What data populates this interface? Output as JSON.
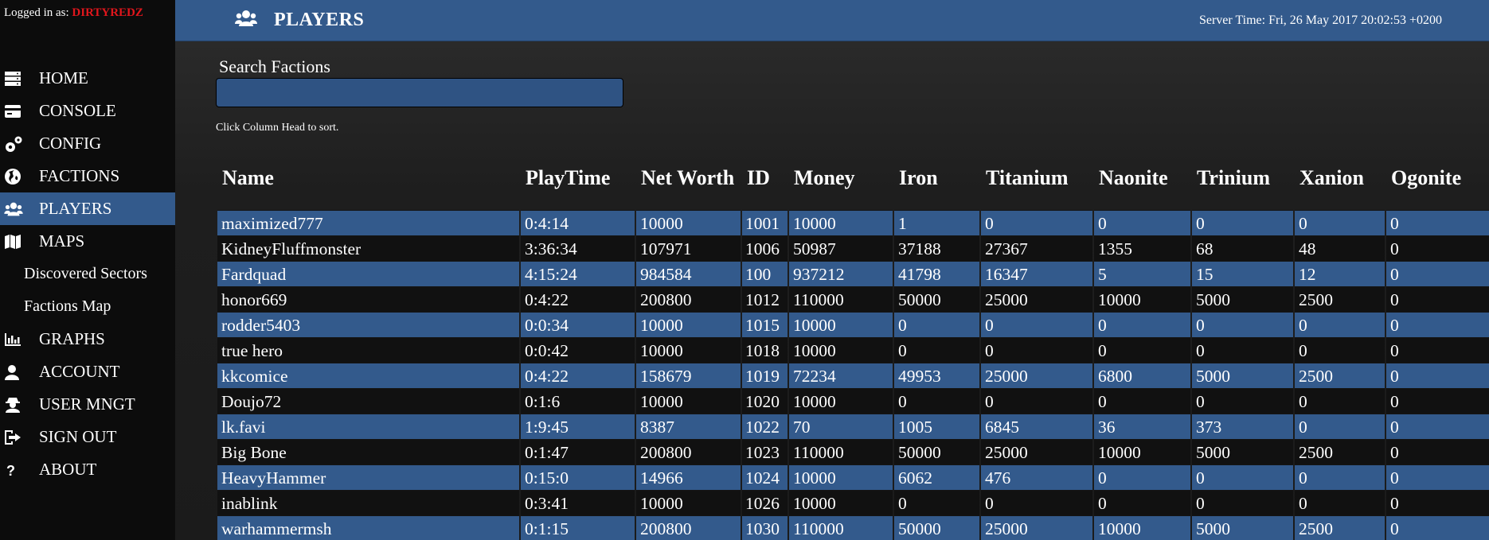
{
  "login": {
    "prefix": "Logged in as:",
    "username": "DIRTYREDZ"
  },
  "nav": [
    {
      "label": "HOME",
      "icon": "server-icon",
      "active": false
    },
    {
      "label": "CONSOLE",
      "icon": "credit-card-icon",
      "active": false
    },
    {
      "label": "CONFIG",
      "icon": "gears-icon",
      "active": false
    },
    {
      "label": "FACTIONS",
      "icon": "globe-icon",
      "active": false
    },
    {
      "label": "PLAYERS",
      "icon": "users-icon",
      "active": true
    },
    {
      "label": "MAPS",
      "icon": "map-icon",
      "active": false
    },
    {
      "label": "Discovered Sectors",
      "icon": "",
      "active": false,
      "sub": true
    },
    {
      "label": "Factions Map",
      "icon": "",
      "active": false,
      "sub": true
    },
    {
      "label": "GRAPHS",
      "icon": "bar-chart-icon",
      "active": false
    },
    {
      "label": "ACCOUNT",
      "icon": "user-icon",
      "active": false
    },
    {
      "label": "USER MNGT",
      "icon": "user-secret-icon",
      "active": false
    },
    {
      "label": "SIGN OUT",
      "icon": "sign-out-icon",
      "active": false
    },
    {
      "label": "ABOUT",
      "icon": "question-icon",
      "active": false
    }
  ],
  "header": {
    "title": "PLAYERS",
    "icon": "users-icon",
    "server_time": "Server Time: Fri, 26 May 2017 20:02:53 +0200"
  },
  "search": {
    "label": "Search Factions",
    "value": "",
    "placeholder": ""
  },
  "sort_hint": "Click Column Head to sort.",
  "table": {
    "columns": [
      "Name",
      "PlayTime",
      "Net Worth",
      "ID",
      "Money",
      "Iron",
      "Titanium",
      "Naonite",
      "Trinium",
      "Xanion",
      "Ogonite"
    ],
    "rows": [
      [
        "maximized777",
        "0:4:14",
        "10000",
        "1001",
        "10000",
        "1",
        "0",
        "0",
        "0",
        "0",
        "0"
      ],
      [
        "KidneyFluffmonster",
        "3:36:34",
        "107971",
        "1006",
        "50987",
        "37188",
        "27367",
        "1355",
        "68",
        "48",
        "0"
      ],
      [
        "Fardquad",
        "4:15:24",
        "984584",
        "100",
        "937212",
        "41798",
        "16347",
        "5",
        "15",
        "12",
        "0"
      ],
      [
        "honor669",
        "0:4:22",
        "200800",
        "1012",
        "110000",
        "50000",
        "25000",
        "10000",
        "5000",
        "2500",
        "0"
      ],
      [
        "rodder5403",
        "0:0:34",
        "10000",
        "1015",
        "10000",
        "0",
        "0",
        "0",
        "0",
        "0",
        "0"
      ],
      [
        "true hero",
        "0:0:42",
        "10000",
        "1018",
        "10000",
        "0",
        "0",
        "0",
        "0",
        "0",
        "0"
      ],
      [
        "kkcomice",
        "0:4:22",
        "158679",
        "1019",
        "72234",
        "49953",
        "25000",
        "6800",
        "5000",
        "2500",
        "0"
      ],
      [
        "Doujo72",
        "0:1:6",
        "10000",
        "1020",
        "10000",
        "0",
        "0",
        "0",
        "0",
        "0",
        "0"
      ],
      [
        "lk.favi",
        "1:9:45",
        "8387",
        "1022",
        "70",
        "1005",
        "6845",
        "36",
        "373",
        "0",
        "0"
      ],
      [
        "Big Bone",
        "0:1:47",
        "200800",
        "1023",
        "110000",
        "50000",
        "25000",
        "10000",
        "5000",
        "2500",
        "0"
      ],
      [
        "HeavyHammer",
        "0:15:0",
        "14966",
        "1024",
        "10000",
        "6062",
        "476",
        "0",
        "0",
        "0",
        "0"
      ],
      [
        "inablink",
        "0:3:41",
        "10000",
        "1026",
        "10000",
        "0",
        "0",
        "0",
        "0",
        "0",
        "0"
      ],
      [
        "warhammermsh",
        "0:1:15",
        "200800",
        "1030",
        "110000",
        "50000",
        "25000",
        "10000",
        "5000",
        "2500",
        "0"
      ]
    ]
  },
  "colors": {
    "accent": "#335a8c",
    "sidebar_bg": "#0c0c0c",
    "username": "#e0161c",
    "row_dark": "#111111"
  }
}
